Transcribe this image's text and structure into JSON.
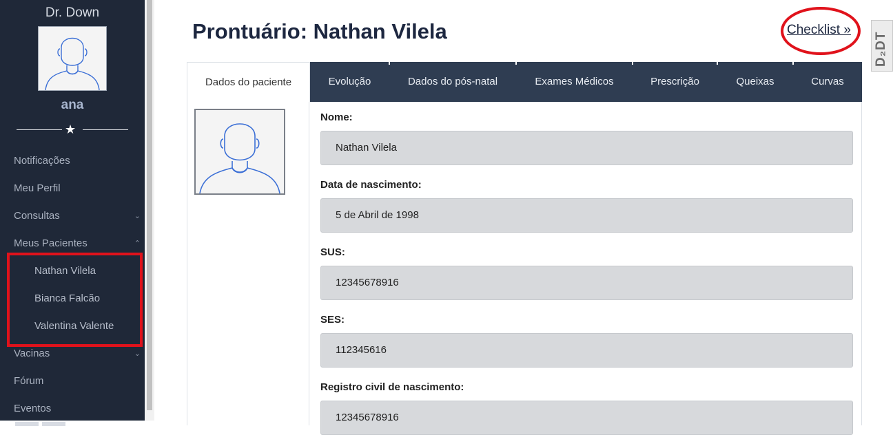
{
  "sidebar": {
    "brand": "Dr. Down",
    "username": "ana",
    "menu": [
      {
        "label": "Notificações"
      },
      {
        "label": "Meu Perfil"
      },
      {
        "label": "Consultas",
        "chevron": "⌄"
      },
      {
        "label": "Meus Pacientes",
        "chevron": "⌃"
      },
      {
        "label": "Nathan Vilela"
      },
      {
        "label": "Bianca Falcão"
      },
      {
        "label": "Valentina Valente"
      },
      {
        "label": "Vacinas",
        "chevron": "⌄"
      },
      {
        "label": "Fórum"
      },
      {
        "label": "Eventos"
      }
    ]
  },
  "header": {
    "title": "Prontuário: Nathan Vilela",
    "checklist_label": "Checklist »",
    "logo_text": "D₂DT"
  },
  "tabs": [
    {
      "label": "Dados do paciente"
    },
    {
      "label": "Evolução"
    },
    {
      "label": "Dados do pós-natal"
    },
    {
      "label": "Exames Médicos"
    },
    {
      "label": "Prescrição"
    },
    {
      "label": "Queixas"
    },
    {
      "label": "Curvas"
    }
  ],
  "fields": [
    {
      "label": "Nome:",
      "value": "Nathan Vilela"
    },
    {
      "label": "Data de nascimento:",
      "value": "5 de Abril de 1998"
    },
    {
      "label": "SUS:",
      "value": "12345678916"
    },
    {
      "label": "SES:",
      "value": "112345616"
    },
    {
      "label": "Registro civil de nascimento:",
      "value": "12345678916"
    }
  ],
  "colors": {
    "sidebar_bg": "#1f2838",
    "tab_bg": "#2f3d52",
    "highlight": "#e0121b",
    "title": "#1d2740"
  }
}
